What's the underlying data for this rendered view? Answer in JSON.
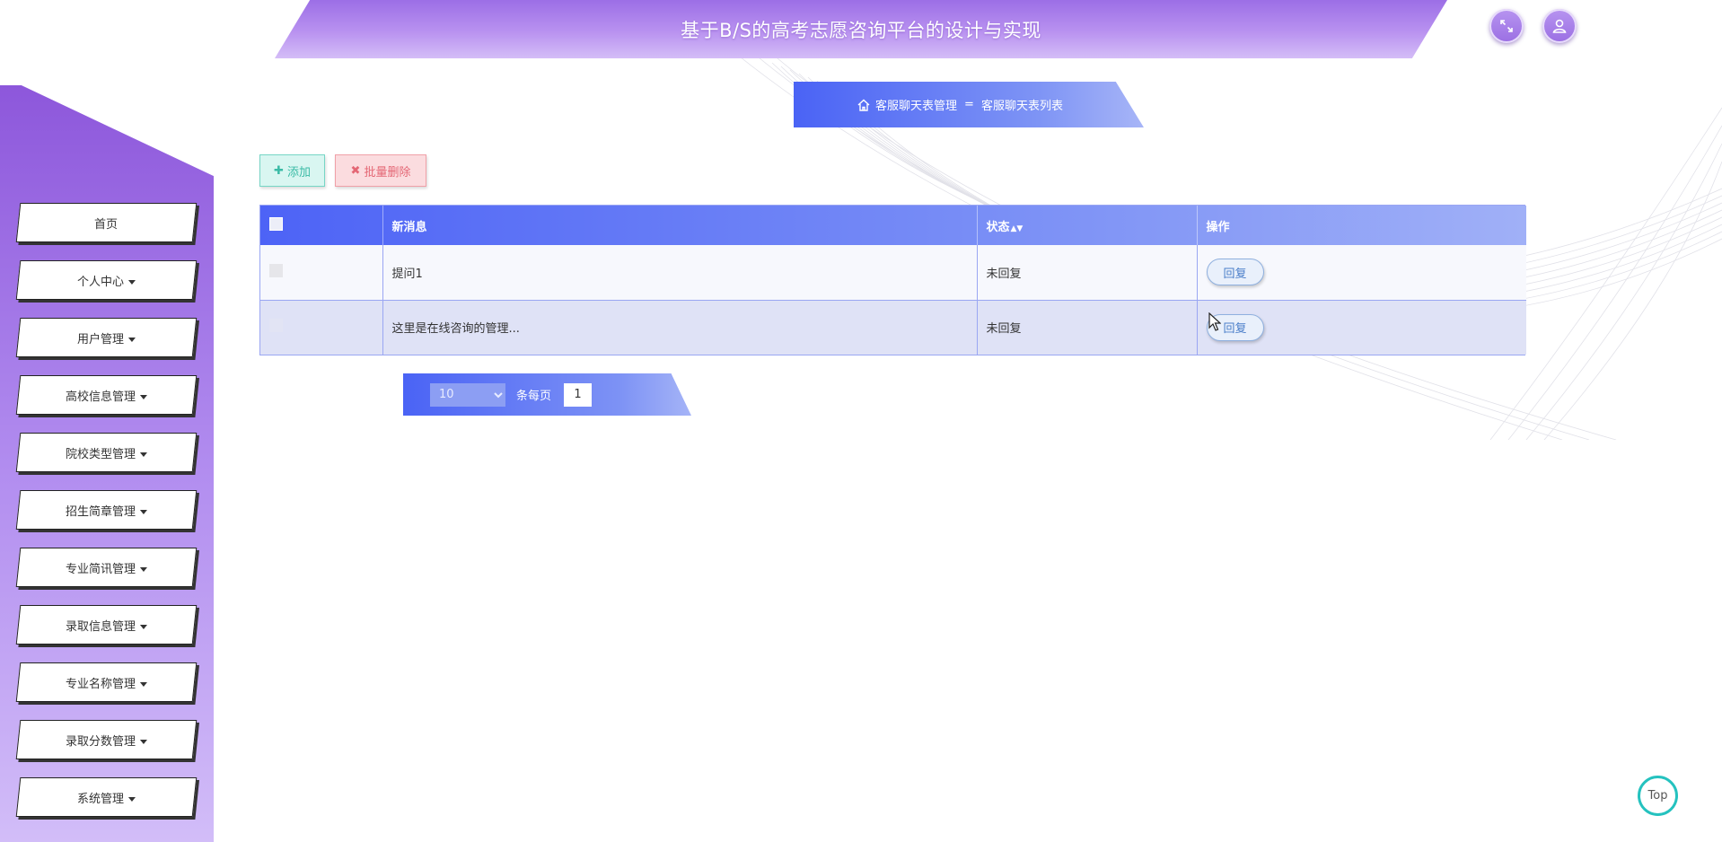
{
  "header": {
    "title": "基于B/S的高考志愿咨询平台的设计与实现",
    "fullscreen_icon": "expand-icon",
    "user_icon": "user-icon"
  },
  "sidebar": {
    "items": [
      {
        "label": "首页",
        "has_dropdown": false
      },
      {
        "label": "个人中心",
        "has_dropdown": true
      },
      {
        "label": "用户管理",
        "has_dropdown": true
      },
      {
        "label": "高校信息管理",
        "has_dropdown": true
      },
      {
        "label": "院校类型管理",
        "has_dropdown": true
      },
      {
        "label": "招生简章管理",
        "has_dropdown": true
      },
      {
        "label": "专业简讯管理",
        "has_dropdown": true
      },
      {
        "label": "录取信息管理",
        "has_dropdown": true
      },
      {
        "label": "专业名称管理",
        "has_dropdown": true
      },
      {
        "label": "录取分数管理",
        "has_dropdown": true
      },
      {
        "label": "系统管理",
        "has_dropdown": true
      }
    ]
  },
  "breadcrumb": {
    "parent": "客服聊天表管理",
    "separator": "=",
    "current": "客服聊天表列表"
  },
  "actions": {
    "add_label": "添加",
    "batch_delete_label": "批量删除"
  },
  "table": {
    "columns": [
      "新消息",
      "状态",
      "操作"
    ],
    "rows": [
      {
        "message": "提问1",
        "status": "未回复",
        "action": "回复"
      },
      {
        "message": "这里是在线咨询的管理...",
        "status": "未回复",
        "action": "回复"
      }
    ]
  },
  "pagination": {
    "page_size": "10",
    "per_page_label": "条每页",
    "current_page": "1"
  },
  "back_to_top": {
    "label": "Top"
  },
  "colors": {
    "sidebar_top": "#8d57db",
    "sidebar_bottom": "#d2bdf8",
    "table_header": "#4d63f6",
    "add_button": "#3bbba6",
    "delete_button": "#e46775",
    "top_button_ring": "#25c2bf"
  }
}
